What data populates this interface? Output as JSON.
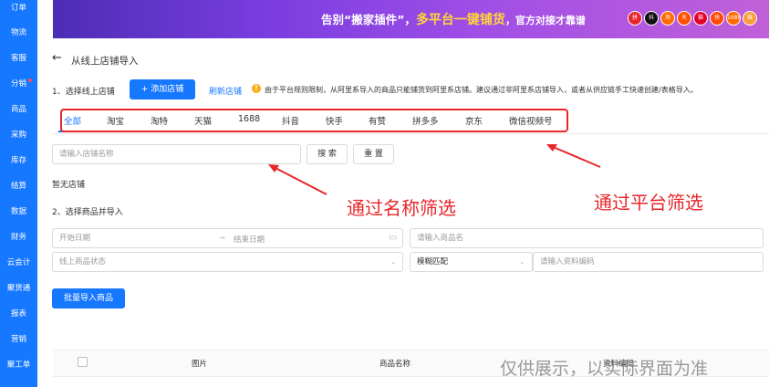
{
  "sidebar": {
    "items": [
      {
        "label": "订单"
      },
      {
        "label": "物流"
      },
      {
        "label": "客服"
      },
      {
        "label": "分销"
      },
      {
        "label": "商品"
      },
      {
        "label": "采购"
      },
      {
        "label": "库存"
      },
      {
        "label": "结算"
      },
      {
        "label": "数据"
      },
      {
        "label": "财务"
      },
      {
        "label": "云会计"
      },
      {
        "label": "聚货通"
      },
      {
        "label": "报表"
      },
      {
        "label": "营销"
      },
      {
        "label": "聚工单"
      }
    ]
  },
  "banner": {
    "text_prefix": "告别“搬家插件”，",
    "text_highlight": "多平台一键铺货",
    "text_suffix": "，官方对接才靠谱",
    "platform_icons": [
      "拼",
      "抖",
      "淘",
      "天",
      "猫",
      "快",
      "1688",
      "微"
    ]
  },
  "page": {
    "title": "从线上店铺导入"
  },
  "step1": {
    "label": "1、选择线上店铺",
    "add_shop_label": "+ 添加店铺",
    "refresh_label": "刷新店铺",
    "note": "由于平台规则限制，从阿里系导入的商品只能铺货到阿里系店铺。建议通过非阿里系店铺导入，或者从供应链手工快速创建/表格导入。"
  },
  "platform_tabs": [
    "全部",
    "淘宝",
    "淘特",
    "天猫",
    "1688",
    "抖音",
    "快手",
    "有赞",
    "拼多多",
    "京东",
    "微信视频号"
  ],
  "shop_search": {
    "placeholder": "请输入店铺名称",
    "search_label": "搜 索",
    "reset_label": "重 置"
  },
  "no_shop_text": "暂无店铺",
  "step2": {
    "label": "2、选择商品并导入",
    "start_date_placeholder": "开始日期",
    "end_date_placeholder": "结束日期",
    "product_name_placeholder": "请输入商品名",
    "status_placeholder": "线上商品状态",
    "match_mode": "模糊匹配",
    "code_placeholder": "请输入资料编码",
    "batch_import_label": "批量导入商品"
  },
  "table": {
    "columns": [
      "图片",
      "商品名称",
      "资料编码"
    ]
  },
  "annotations": {
    "by_name": "通过名称筛选",
    "by_platform": "通过平台筛选",
    "color": "#e8262a"
  },
  "watermark": "仅供展示，以实际界面为准",
  "colors": {
    "primary": "#1677ff",
    "sidebar": "#1677ff",
    "warning": "#faad14"
  }
}
